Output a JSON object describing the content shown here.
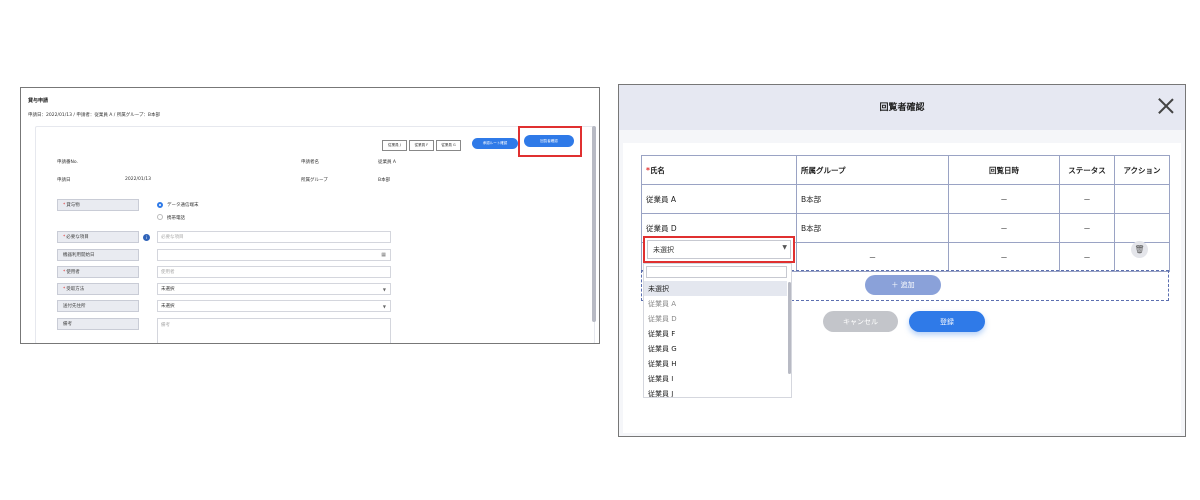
{
  "left_panel": {
    "title": "貸与申請",
    "subinfo": "申請日：2022/01/13 / 申請者：従業員 A / 所属グループ：B本部",
    "small_buttons": [
      "従業員 J",
      "従業員 F",
      "従業員 G"
    ],
    "blue_buttons": [
      "承認ルート確認",
      "回覧者確認"
    ],
    "info_rows": [
      {
        "label": "申請番No.",
        "value": "",
        "label2": "申請者名",
        "value2": "従業員 A"
      },
      {
        "label": "申請日",
        "value": "2022/01/13",
        "label2": "所属グループ",
        "value2": "B本部"
      }
    ],
    "form": {
      "lend_label": "貸与物",
      "lend_options": [
        "データ通信端末",
        "携帯電話"
      ],
      "required_item_label": "必要な項目",
      "required_item_placeholder": "必要な項目",
      "start_date_label": "機器利用開始日",
      "user_label": "使用者",
      "user_placeholder": "使用者",
      "receipt_label": "受取方法",
      "receipt_value": "未選択",
      "shipping_label": "送付先住所",
      "shipping_value": "未選択",
      "remarks_label": "備考",
      "remarks_placeholder": "備考"
    }
  },
  "dialog": {
    "title": "回覧者確認",
    "columns": [
      "氏名",
      "所属グループ",
      "回覧日時",
      "ステータス",
      "アクション"
    ],
    "rows": [
      {
        "name": "従業員 A",
        "group": "B本部",
        "date": "－",
        "status": "－"
      },
      {
        "name": "従業員 D",
        "group": "B本部",
        "date": "－",
        "status": "－"
      }
    ],
    "new_row": {
      "select_value": "未選択",
      "group": "－",
      "date": "－",
      "status": "－"
    },
    "dropdown_options": [
      "未選択",
      "従業員 A",
      "従業員 D",
      "従業員 F",
      "従業員 G",
      "従業員 H",
      "従業員 I",
      "従業員 J"
    ],
    "add_button": "＋ 追加",
    "cancel_button": "キャンセル",
    "register_button": "登録"
  }
}
